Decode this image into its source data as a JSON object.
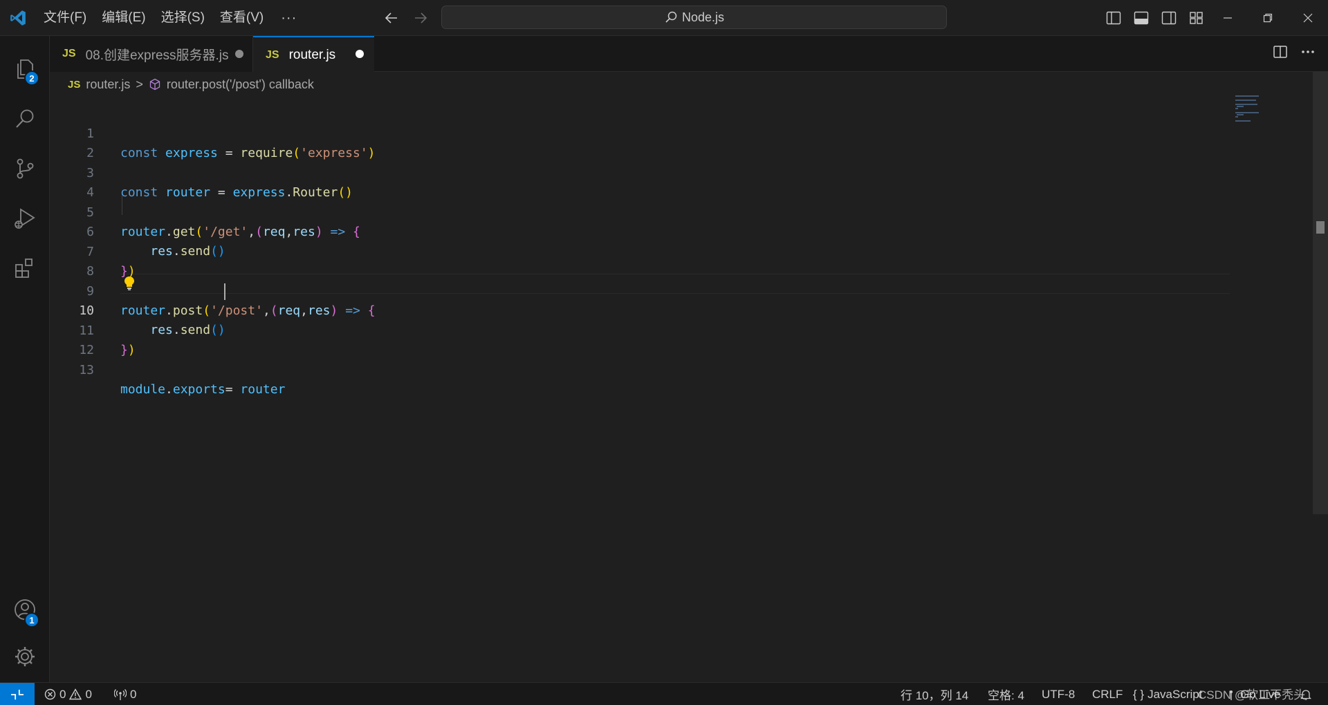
{
  "titlebar": {
    "menu": [
      "文件(F)",
      "编辑(E)",
      "选择(S)",
      "查看(V)"
    ],
    "more": "···",
    "search_text": "Node.js"
  },
  "activitybar": {
    "explorer_badge": "2",
    "accounts_badge": "1"
  },
  "tabs": [
    {
      "icon": "JS",
      "label": "08.创建express服务器.js",
      "dirty": true,
      "active": false
    },
    {
      "icon": "JS",
      "label": "router.js",
      "dirty": true,
      "active": true
    }
  ],
  "breadcrumb": {
    "file_icon": "JS",
    "file": "router.js",
    "separator": ">",
    "symbol": "router.post('/post') callback"
  },
  "editor": {
    "active_line": 10,
    "line_numbers": [
      "1",
      "2",
      "3",
      "4",
      "5",
      "6",
      "7",
      "8",
      "9",
      "10",
      "11",
      "12",
      "13"
    ],
    "lines": [
      "const express = require('express')",
      "",
      "const router = express.Router()",
      "",
      "router.get('/get',(req,res) => {",
      "    res.send()",
      "})",
      "",
      "router.post('/post',(req,res) => {",
      "    res.send()",
      "})",
      "",
      "module.exports= router"
    ]
  },
  "statusbar": {
    "errors": "0",
    "warnings": "0",
    "ports": "0",
    "position": "行 10，列 14",
    "spaces": "空格: 4",
    "encoding": "UTF-8",
    "eol": "CRLF",
    "language_icon": "{ }",
    "language": "JavaScript",
    "golive": "Go Live"
  },
  "watermark": "CSDN @软工不秃头",
  "colors": {
    "accent": "#0078d4",
    "js_icon": "#cbcb41",
    "dirty_inactive": "#8b8b8b",
    "dirty_active": "#ffffff"
  }
}
